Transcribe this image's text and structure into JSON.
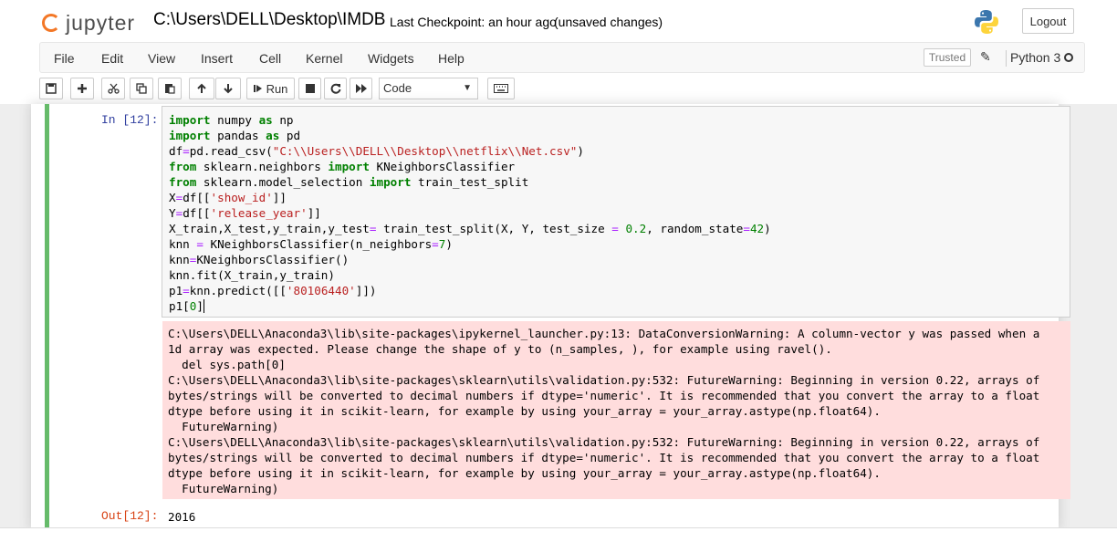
{
  "header": {
    "logo_text": "jupyter",
    "notebook_name": "C:\\Users\\DELL\\Desktop\\IMDB",
    "checkpoint": "Last Checkpoint: an hour ago",
    "save_status": "(unsaved changes)",
    "logout_label": "Logout"
  },
  "menubar": {
    "items": [
      "File",
      "Edit",
      "View",
      "Insert",
      "Cell",
      "Kernel",
      "Widgets",
      "Help"
    ],
    "trusted_label": "Trusted",
    "kernel_name": "Python 3"
  },
  "toolbar": {
    "run_label": "Run",
    "cell_type": "Code",
    "icons": [
      "save-icon",
      "plus-icon",
      "cut-icon",
      "copy-icon",
      "paste-icon",
      "arrow-up-icon",
      "arrow-down-icon",
      "step-forward-icon",
      "stop-icon",
      "restart-icon",
      "fast-forward-icon",
      "keyboard-icon"
    ]
  },
  "cell": {
    "input_prompt": "In [12]:",
    "output_prompt": "Out[12]:",
    "output_value": "2016",
    "code_lines": [
      "import numpy as np",
      "import pandas as pd",
      "df=pd.read_csv(\"C:\\\\Users\\\\DELL\\\\Desktop\\\\netflix\\\\Net.csv\")",
      "from sklearn.neighbors import KNeighborsClassifier",
      "from sklearn.model_selection import train_test_split",
      "X=df[['show_id']]",
      "Y=df[['release_year']]",
      "X_train,X_test,y_train,y_test= train_test_split(X, Y, test_size = 0.2, random_state=42)",
      "knn = KNeighborsClassifier(n_neighbors=7)",
      "knn=KNeighborsClassifier()",
      "knn.fit(X_train,y_train)",
      "p1=knn.predict([['80106440']])",
      "p1[0]"
    ],
    "stderr_lines": [
      "C:\\Users\\DELL\\Anaconda3\\lib\\site-packages\\ipykernel_launcher.py:13: DataConversionWarning: A column-vector y was passed when a",
      "1d array was expected. Please change the shape of y to (n_samples, ), for example using ravel().",
      "  del sys.path[0]",
      "C:\\Users\\DELL\\Anaconda3\\lib\\site-packages\\sklearn\\utils\\validation.py:532: FutureWarning: Beginning in version 0.22, arrays of",
      "bytes/strings will be converted to decimal numbers if dtype='numeric'. It is recommended that you convert the array to a float",
      "dtype before using it in scikit-learn, for example by using your_array = your_array.astype(np.float64).",
      "  FutureWarning)",
      "C:\\Users\\DELL\\Anaconda3\\lib\\site-packages\\sklearn\\utils\\validation.py:532: FutureWarning: Beginning in version 0.22, arrays of",
      "bytes/strings will be converted to decimal numbers if dtype='numeric'. It is recommended that you convert the array to a float",
      "dtype before using it in scikit-learn, for example by using your_array = your_array.astype(np.float64).",
      "  FutureWarning)"
    ]
  },
  "colors": {
    "accent_orange": "#f37726",
    "cell_selected_border": "#66bb6a",
    "stderr_background": "#ffdddd",
    "prompt_in": "#303f9f",
    "prompt_out": "#d84315"
  }
}
